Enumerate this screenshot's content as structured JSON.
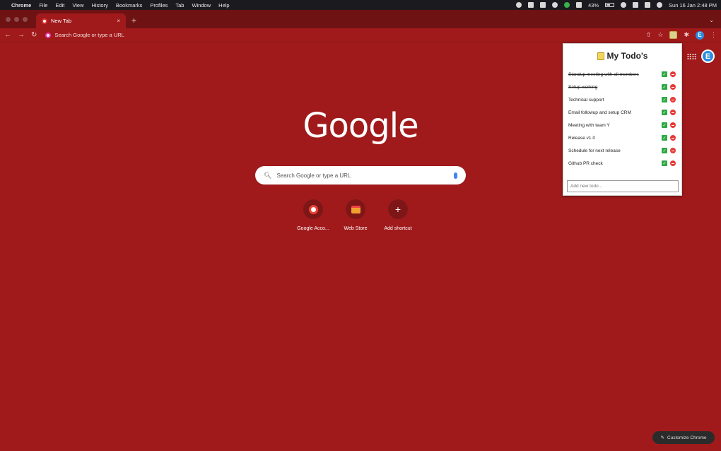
{
  "menubar": {
    "items": [
      "Chrome",
      "File",
      "Edit",
      "View",
      "History",
      "Bookmarks",
      "Profiles",
      "Tab",
      "Window",
      "Help"
    ],
    "battery": "43%",
    "datetime": "Sun 16 Jan  2:48 PM"
  },
  "tab": {
    "title": "New Tab",
    "close": "×",
    "new_tab": "+",
    "tab_menu": "⌄"
  },
  "omnibox": {
    "placeholder": "Search Google or type a URL"
  },
  "page": {
    "logo": "Google",
    "search_placeholder": "Search Google or type a URL",
    "shortcuts": [
      {
        "label": "Google Acco..."
      },
      {
        "label": "Web Store"
      },
      {
        "label": "Add shortcut"
      }
    ],
    "customize_label": "Customize Chrome",
    "account_letter": "E"
  },
  "popup": {
    "title": "My Todo's",
    "add_placeholder": "Add new todo...",
    "todos": [
      {
        "text": "Standup meeting with all members",
        "done": true
      },
      {
        "text": "Setup working",
        "done": true
      },
      {
        "text": "Technical support",
        "done": false
      },
      {
        "text": "Email followup and setup CRM",
        "done": false
      },
      {
        "text": "Meeting with team Y",
        "done": false
      },
      {
        "text": "Release v1.0",
        "done": false
      },
      {
        "text": "Schedule for next release",
        "done": false
      },
      {
        "text": "Github PR check",
        "done": false
      }
    ]
  },
  "colors": {
    "theme": "#a01a1b",
    "tabstrip": "#6f1214",
    "check": "#2fa844",
    "delete": "#e53935"
  }
}
